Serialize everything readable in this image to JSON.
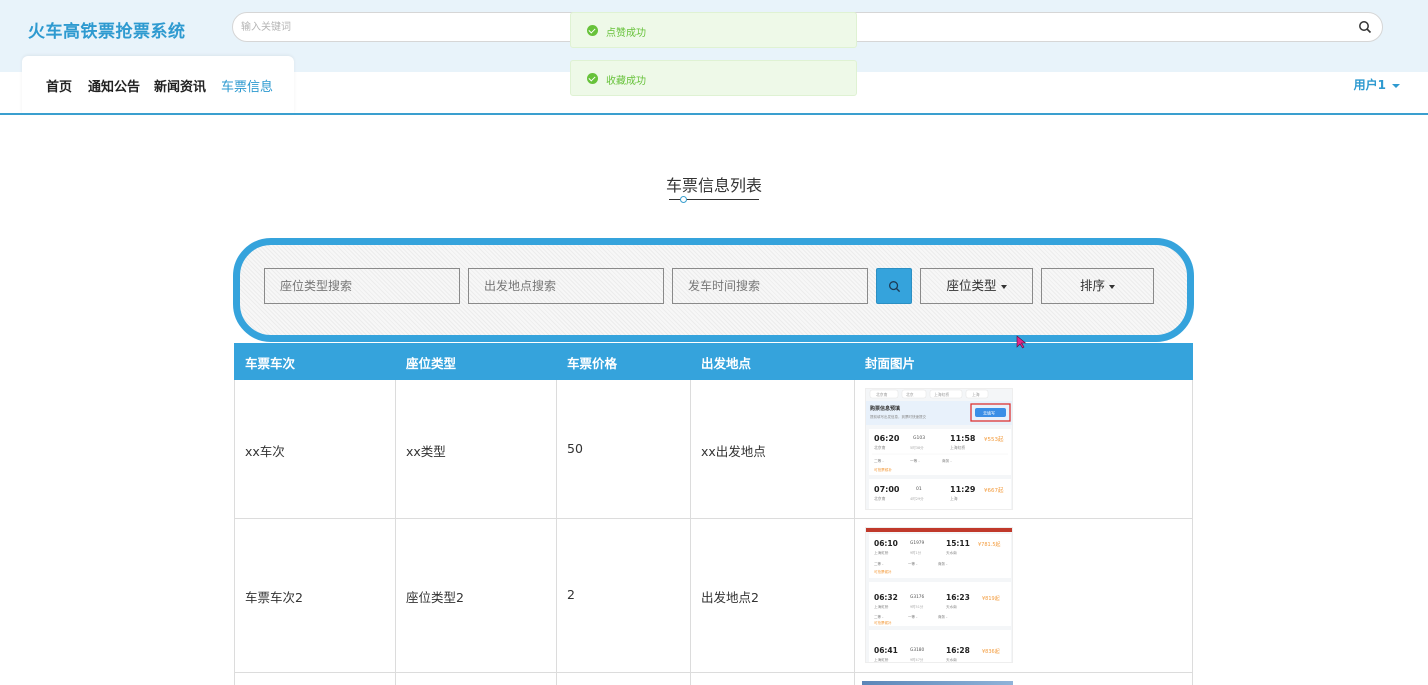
{
  "header": {
    "brand": "火车高铁票抢票系统",
    "search_placeholder": "输入关键词"
  },
  "nav": {
    "items": [
      {
        "label": "首页",
        "active": false
      },
      {
        "label": "通知公告",
        "active": false
      },
      {
        "label": "新闻资讯",
        "active": false
      },
      {
        "label": "车票信息",
        "active": true
      }
    ],
    "user": "用户1"
  },
  "toasts": [
    {
      "text": "点赞成功"
    },
    {
      "text": "收藏成功"
    }
  ],
  "section": {
    "title": "车票信息列表"
  },
  "filters": {
    "seat_type_placeholder": "座位类型搜索",
    "departure_placeholder": "出发地点搜索",
    "time_placeholder": "发车时间搜索",
    "seat_type_dropdown": "座位类型",
    "sort_dropdown": "排序"
  },
  "table": {
    "columns": [
      "车票车次",
      "座位类型",
      "车票价格",
      "出发地点",
      "封面图片"
    ],
    "rows": [
      {
        "train": "xx车次",
        "seat": "xx类型",
        "price": "50",
        "origin": "xx出发地点"
      },
      {
        "train": "车票车次2",
        "seat": "座位类型2",
        "price": "2",
        "origin": "出发地点2"
      }
    ]
  },
  "thumbs": {
    "t1": {
      "tabs": [
        "北京南",
        "北京",
        "上海虹桥",
        "上海"
      ],
      "banner_title": "购票信息预填",
      "banner_sub": "提前填写出发信息，到票时快速提交",
      "banner_btn": "去填写",
      "trips": [
        {
          "dep": "06:20",
          "no": "G103",
          "arr": "11:58",
          "price": "¥553起",
          "from": "北京南",
          "dur": "5时38分",
          "to": "上海虹桥"
        },
        {
          "dep": "07:00",
          "no": "01",
          "arr": "11:29",
          "price": "¥667起",
          "from": "北京南",
          "dur": "4时29分",
          "to": "上海"
        }
      ],
      "seats": [
        "二等 -",
        "一等 -",
        "商务 -"
      ],
      "note": "可抢票候补"
    },
    "t2": {
      "trips": [
        {
          "dep": "06:10",
          "no": "G1979",
          "arr": "15:11",
          "price": "¥781.5起",
          "from": "上海虹桥",
          "dur": "9时1分",
          "to": "天水南"
        },
        {
          "dep": "06:32",
          "no": "G3176",
          "arr": "16:23",
          "price": "¥819起",
          "from": "上海虹桥",
          "dur": "9时51分",
          "to": "天水南"
        },
        {
          "dep": "06:41",
          "no": "G3180",
          "arr": "16:28",
          "price": "¥836起",
          "from": "上海虹桥",
          "dur": "9时47分",
          "to": "天水南"
        }
      ],
      "seats": [
        "二等 -",
        "一等 -",
        "商务 -"
      ],
      "note": "可抢票候补"
    }
  },
  "colors": {
    "accent": "#35a3dc",
    "brand": "#2e9ad0",
    "success": "#67c23a",
    "header_bg": "#e8f3fa"
  }
}
